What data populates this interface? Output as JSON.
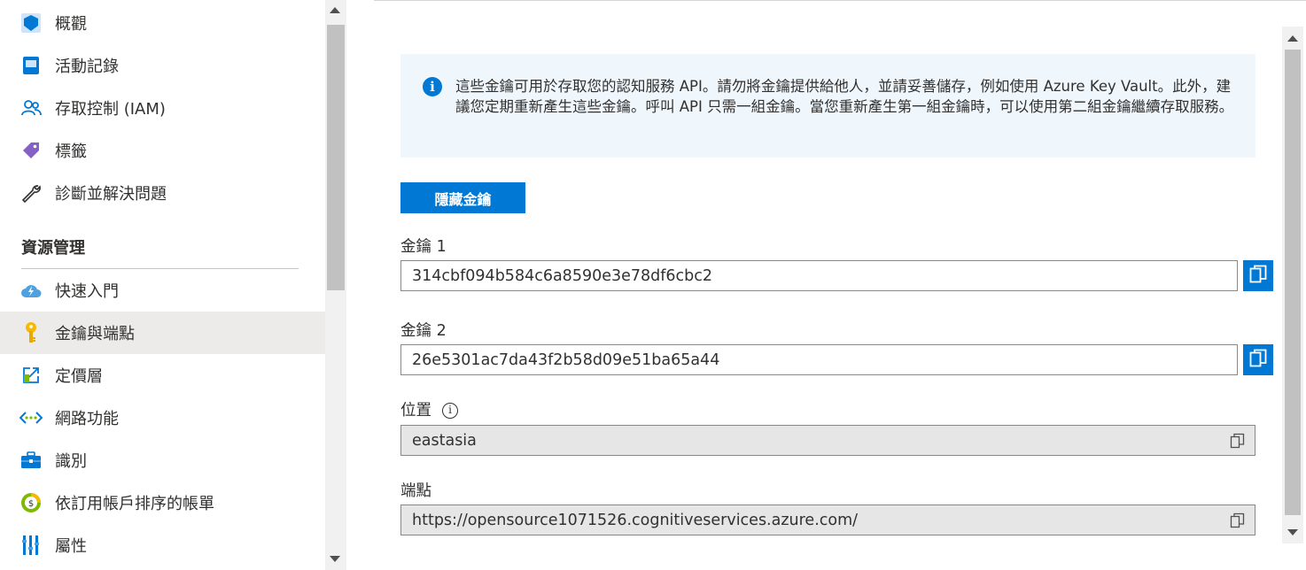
{
  "sidebar": {
    "items": [
      {
        "label": "概觀",
        "icon": "overview-icon"
      },
      {
        "label": "活動記錄",
        "icon": "activity-log-icon"
      },
      {
        "label": "存取控制 (IAM)",
        "icon": "access-control-icon"
      },
      {
        "label": "標籤",
        "icon": "tag-icon"
      },
      {
        "label": "診斷並解決問題",
        "icon": "wrench-icon"
      }
    ],
    "section_header": "資源管理",
    "section_items": [
      {
        "label": "快速入門",
        "icon": "quickstart-cloud-icon"
      },
      {
        "label": "金鑰與端點",
        "icon": "key-icon",
        "selected": true
      },
      {
        "label": "定價層",
        "icon": "pricing-tier-icon"
      },
      {
        "label": "網路功能",
        "icon": "networking-icon"
      },
      {
        "label": "識別",
        "icon": "identity-icon"
      },
      {
        "label": "依訂用帳戶排序的帳單",
        "icon": "billing-icon"
      },
      {
        "label": "屬性",
        "icon": "properties-icon"
      }
    ]
  },
  "main": {
    "info_text": "這些金鑰可用於存取您的認知服務 API。請勿將金鑰提供給他人，並請妥善儲存，例如使用 Azure Key Vault。此外，建議您定期重新產生這些金鑰。呼叫 API 只需一組金鑰。當您重新產生第一組金鑰時，可以使用第二組金鑰繼續存取服務。",
    "hide_keys_button": "隱藏金鑰",
    "key1": {
      "label": "金鑰 1",
      "value": "314cbf094b584c6a8590e3e78df6cbc2"
    },
    "key2": {
      "label": "金鑰 2",
      "value": "26e5301ac7da43f2b58d09e51ba65a44"
    },
    "location": {
      "label": "位置",
      "value": "eastasia"
    },
    "endpoint": {
      "label": "端點",
      "value": "https://opensource1071526.cognitiveservices.azure.com/"
    }
  },
  "colors": {
    "accent": "#0078d4",
    "info_background": "#eff6fc",
    "selected_nav": "#edebe9",
    "readonly_field": "#e6e6e6"
  }
}
